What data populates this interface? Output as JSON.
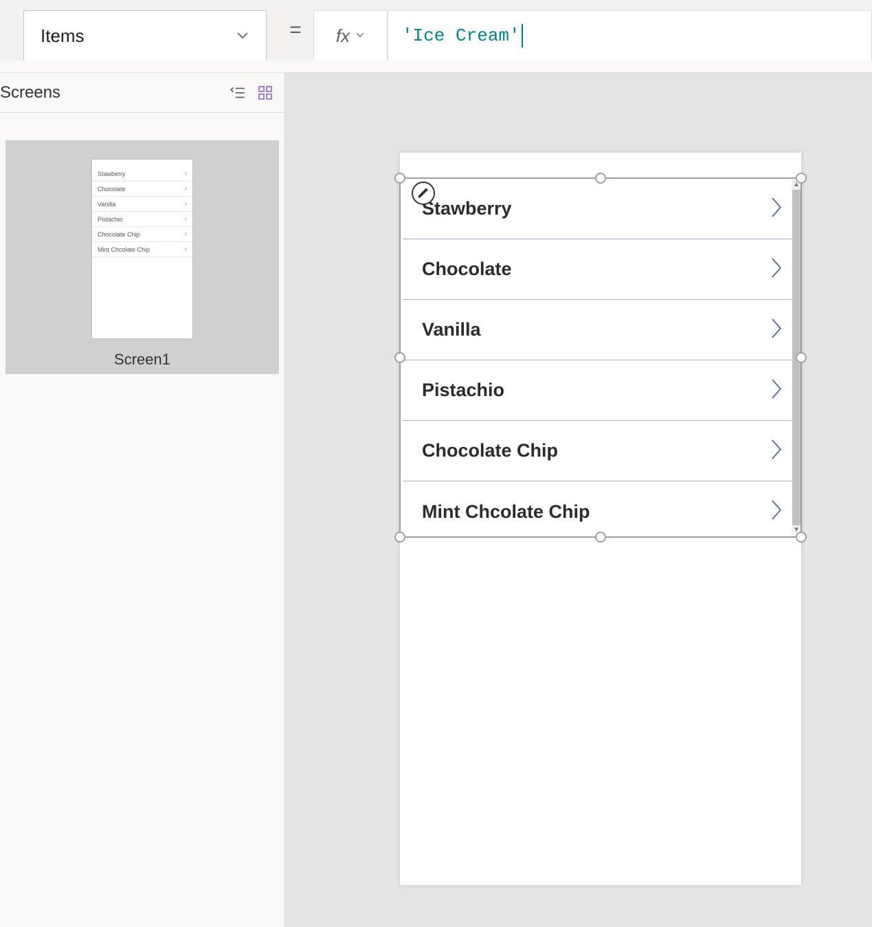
{
  "formula_bar": {
    "property": "Items",
    "fx_label": "fx",
    "value": "'Ice Cream'"
  },
  "left_panel": {
    "title": "Screens",
    "thumbnail_label": "Screen1"
  },
  "gallery": {
    "items": [
      {
        "label": "Stawberry"
      },
      {
        "label": "Chocolate"
      },
      {
        "label": "Vanilla"
      },
      {
        "label": "Pistachio"
      },
      {
        "label": "Chocolate Chip"
      },
      {
        "label": "Mint Chcolate Chip"
      }
    ]
  }
}
